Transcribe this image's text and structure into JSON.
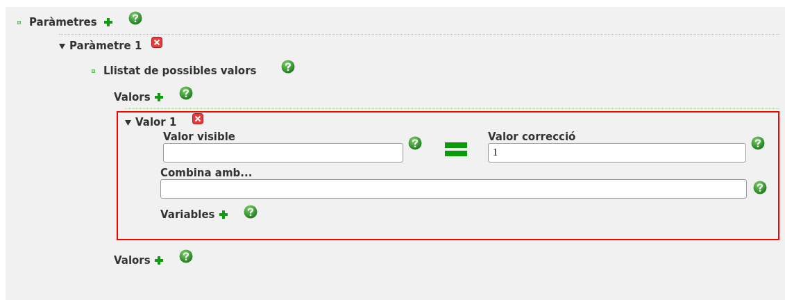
{
  "parameters": {
    "label": "Paràmetres",
    "items": [
      {
        "label": "Paràmetre 1",
        "expanded": true,
        "value_list": {
          "label": "Llistat de possibles valors",
          "groups": [
            {
              "label": "Valors",
              "values": [
                {
                  "label": "Valor 1",
                  "expanded": true,
                  "selected": true,
                  "visible_label": "Valor visible",
                  "correction_label": "Valor correcció",
                  "correction_value": "1",
                  "combine_label": "Combina amb...",
                  "variables_label": "Variables"
                }
              ]
            },
            {
              "label": "Valors"
            }
          ]
        }
      }
    ]
  }
}
